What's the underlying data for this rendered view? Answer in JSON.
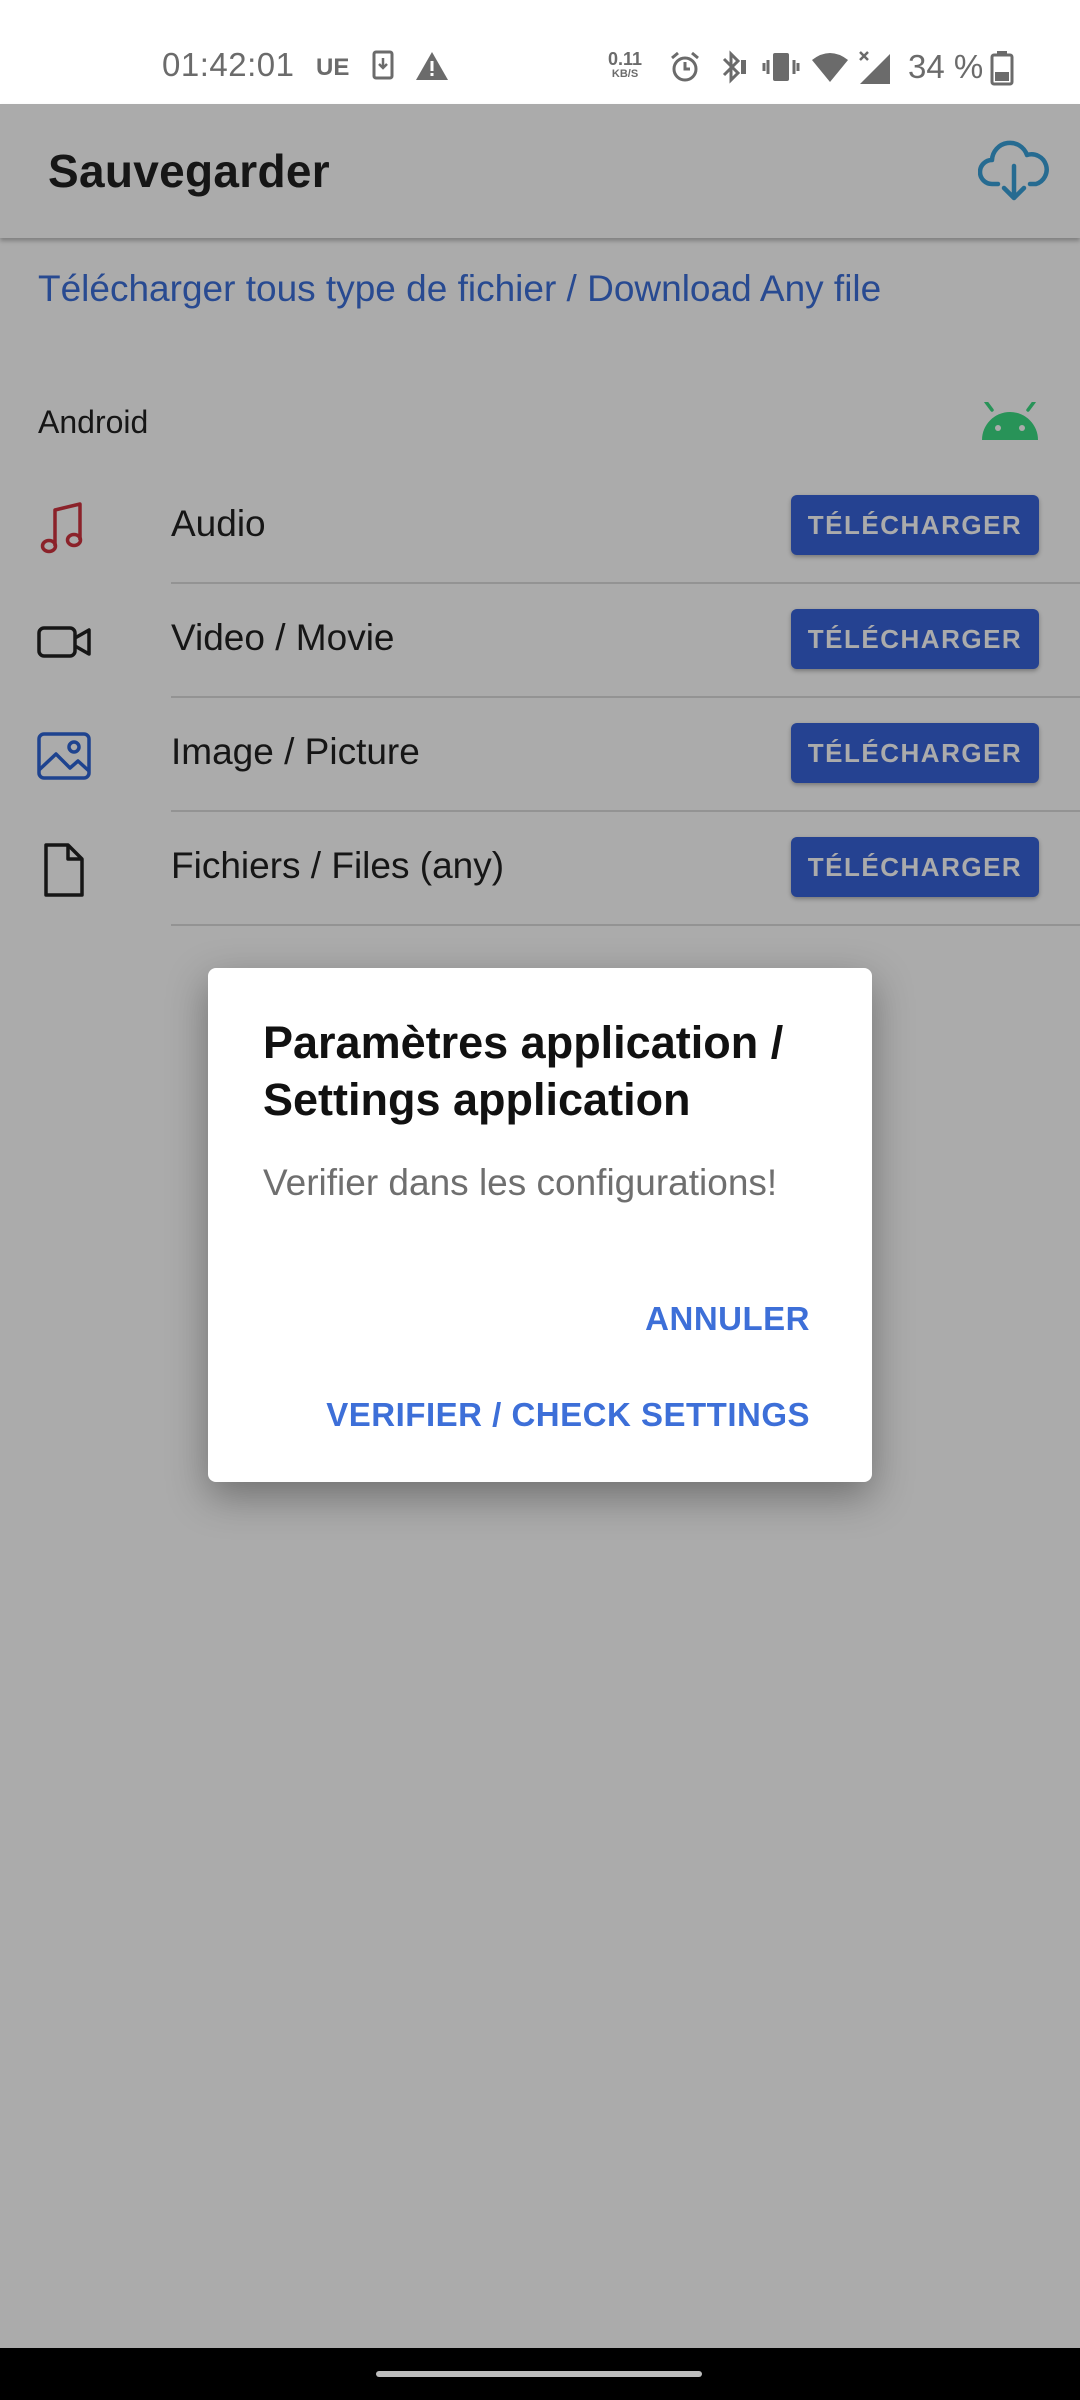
{
  "status_bar": {
    "time": "01:42:01",
    "carrier": "UE",
    "net_speed_value": "0.11",
    "net_speed_unit": "KB/S",
    "battery": "34 %",
    "icons": [
      "download-notification-icon",
      "warning-icon",
      "alarm-icon",
      "bluetooth-icon",
      "vibrate-icon",
      "wifi-icon",
      "signal-icon",
      "battery-icon"
    ]
  },
  "app_bar": {
    "title": "Sauvegarder",
    "action_icon": "cloud-download-icon",
    "action_color": "#3aa0d8"
  },
  "main": {
    "headline": "Télécharger tous type de fichier / Download Any file",
    "section_label": "Android",
    "section_icon": "android-icon",
    "rows": [
      {
        "label": "Audio",
        "icon": "music-note-icon",
        "button": "TÉLÉCHARGER"
      },
      {
        "label": "Video / Movie",
        "icon": "video-camera-icon",
        "button": "TÉLÉCHARGER"
      },
      {
        "label": "Image / Picture",
        "icon": "image-icon",
        "button": "TÉLÉCHARGER"
      },
      {
        "label": "Fichiers / Files (any)",
        "icon": "file-icon",
        "button": "TÉLÉCHARGER"
      }
    ]
  },
  "dialog": {
    "title": "Paramètres application / Settings application",
    "message": "Verifier dans les configurations!",
    "cancel_label": "ANNULER",
    "confirm_label": "VERIFIER / CHECK SETTINGS"
  },
  "colors": {
    "accent": "#3d6fd8",
    "button_bg": "#3863d8",
    "audio_icon": "#d0343f",
    "image_icon": "#2e64d6",
    "android_green": "#3ddc84"
  }
}
